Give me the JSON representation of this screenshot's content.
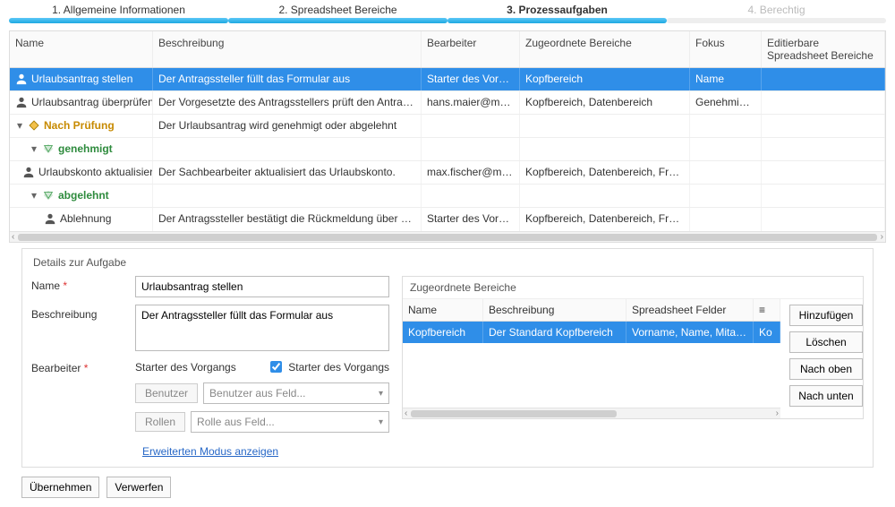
{
  "wizard": {
    "s1": "1. Allgemeine Informationen",
    "s2": "2. Spreadsheet Bereiche",
    "s3": "3. Prozessaufgaben",
    "s4": "4. Berechtig"
  },
  "grid": {
    "head": {
      "name": "Name",
      "desc": "Beschreibung",
      "editor": "Bearbeiter",
      "assigned": "Zugeordnete Bereiche",
      "focus": "Fokus",
      "editable": "Editierbare Spreadsheet Bereiche"
    },
    "rows": [
      {
        "indent": 0,
        "icon": "user",
        "name": "Urlaubsantrag stellen",
        "desc": "Der Antragssteller füllt das Formular aus",
        "editor": "Starter des Vorgangs",
        "assigned": "Kopfbereich",
        "focus": "Name",
        "sel": true
      },
      {
        "indent": 0,
        "icon": "user",
        "name": "Urlaubsantrag überprüfen",
        "desc": "Der Vorgesetzte des Antragsstellers prüft den Antrag und entscheidet über ihn.",
        "editor": "hans.maier@maier.de",
        "assigned": "Kopfbereich, Datenbereich",
        "focus": "Genehmigung"
      },
      {
        "indent": 0,
        "icon": "branch",
        "name": "Nach Prüfung",
        "cls": "orange",
        "desc": "Der Urlaubsantrag wird genehmigt oder abgelehnt",
        "tw": true
      },
      {
        "indent": 1,
        "icon": "case",
        "name": "genehmigt",
        "cls": "green",
        "tw": true
      },
      {
        "indent": 2,
        "icon": "user",
        "name": "Urlaubskonto aktualisieren",
        "desc": "Der Sachbearbeiter aktualisiert das Urlaubskonto.",
        "editor": "max.fischer@maier.de",
        "assigned": "Kopfbereich, Datenbereich, Freigabebereich"
      },
      {
        "indent": 1,
        "icon": "case",
        "name": "abgelehnt",
        "cls": "green",
        "tw": true
      },
      {
        "indent": 2,
        "icon": "user",
        "name": "Ablehnung",
        "desc": "Der Antragssteller bestätigt die Rückmeldung über die Ablehnung.",
        "editor": "Starter des Vorgangs",
        "assigned": "Kopfbereich, Datenbereich, Freigabebereich",
        "cut": true
      }
    ]
  },
  "details": {
    "title": "Details zur Aufgabe",
    "name_label": "Name",
    "name_value": "Urlaubsantrag stellen",
    "desc_label": "Beschreibung",
    "desc_value": "Der Antragssteller füllt das Formular aus",
    "editor_label": "Bearbeiter",
    "editor_value": "Starter des Vorgangs",
    "starter_chk": "Starter des Vorgangs",
    "user_btn": "Benutzer",
    "user_ph": "Benutzer aus Feld...",
    "role_btn": "Rollen",
    "role_ph": "Rolle aus Feld...",
    "advanced": "Erweiterten Modus anzeigen"
  },
  "assigned": {
    "title": "Zugeordnete Bereiche",
    "head": {
      "name": "Name",
      "desc": "Beschreibung",
      "fields": "Spreadsheet Felder",
      "menu": "≡"
    },
    "row": {
      "name": "Kopfbereich",
      "desc": "Der Standard Kopfbereich",
      "fields": "Vorname, Name, Mitarbeiter...",
      "extra": "Ko"
    },
    "btns": {
      "add": "Hinzufügen",
      "del": "Löschen",
      "up": "Nach oben",
      "down": "Nach unten"
    }
  },
  "footer": {
    "apply": "Übernehmen",
    "discard": "Verwerfen"
  }
}
